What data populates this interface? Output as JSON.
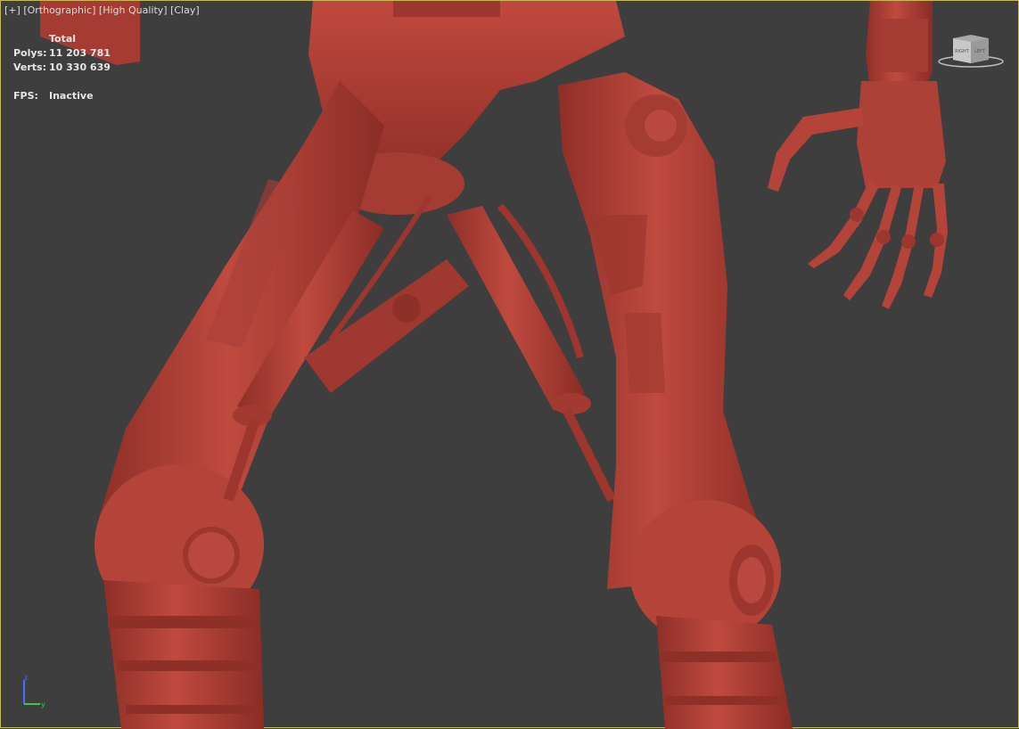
{
  "viewport": {
    "labels": [
      "[+]",
      "[Orthographic]",
      "[High Quality]",
      "[Clay]"
    ],
    "stats": {
      "header": "Total",
      "polys_label": "Polys:",
      "polys_value": "11 203 781",
      "verts_label": "Verts:",
      "verts_value": "10 330 639",
      "fps_label": "FPS:",
      "fps_value": "Inactive"
    },
    "viewcube": {
      "left_face": "RIGHT",
      "right_face": "LEFT"
    },
    "axis": {
      "z": "z",
      "y": "y"
    }
  },
  "colors": {
    "background": "#3e3e3e",
    "clay": "#b9463c",
    "viewport_border": "#c8b85a",
    "axis_z": "#4a6cff",
    "axis_y": "#3ec94a"
  }
}
